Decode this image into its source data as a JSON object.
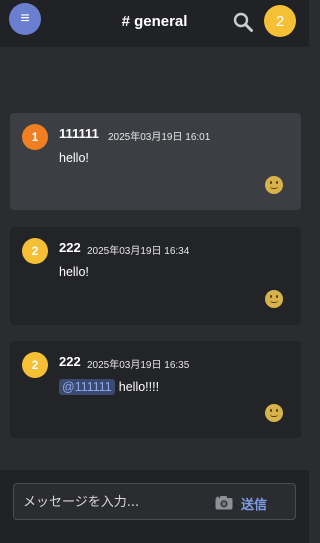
{
  "header": {
    "menu_glyph": "≡",
    "channel": "# general",
    "user_avatar": "2"
  },
  "messages": [
    {
      "avatar": "1",
      "avatar_color": "#f07e22",
      "username": "111111",
      "timestamp": "2025年03月19日 16:01",
      "text": "hello!",
      "mention": "",
      "reaction": "smile-emoji",
      "highlight": true
    },
    {
      "avatar": "2",
      "avatar_color": "#f5c035",
      "username": "222",
      "timestamp": "2025年03月19日 16:34",
      "text": "hello!",
      "mention": "",
      "reaction": "smile-emoji",
      "highlight": false
    },
    {
      "avatar": "2",
      "avatar_color": "#f5c035",
      "username": "222",
      "timestamp": "2025年03月19日 16:35",
      "text": "hello!!!!",
      "mention": "@111111",
      "reaction": "smile-emoji",
      "highlight": false
    }
  ],
  "composer": {
    "placeholder": "メッセージを入力...",
    "send_label": "送信"
  },
  "colors": {
    "accent": "#6b7fd0",
    "link": "#7f9ce6"
  }
}
